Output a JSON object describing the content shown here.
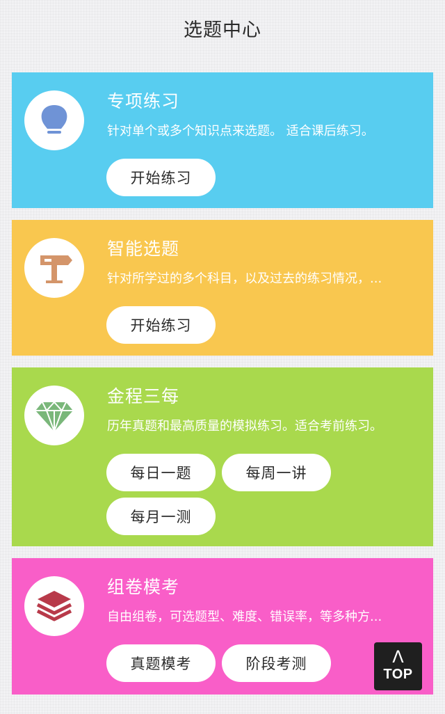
{
  "header": {
    "title": "选题中心"
  },
  "cards": [
    {
      "title": "专项练习",
      "desc": "针对单个或多个知识点来选题。 适合课后练习。",
      "icon": "lightbulb-icon",
      "color": "#58cdf0",
      "buttons": [
        "开始练习"
      ]
    },
    {
      "title": "智能选题",
      "desc": "针对所学过的多个科目，以及过去的练习情况，...",
      "icon": "signpost-icon",
      "color": "#f9c74f",
      "buttons": [
        "开始练习"
      ]
    },
    {
      "title": "金程三每",
      "desc": "历年真题和最高质量的模拟练习。适合考前练习。",
      "icon": "diamond-icon",
      "color": "#a9d94d",
      "buttons": [
        "每日一题",
        "每周一讲",
        "每月一测"
      ]
    },
    {
      "title": "组卷模考",
      "desc": "自由组卷，可选题型、难度、错误率，等多种方...",
      "icon": "layers-icon",
      "color": "#f95ec8",
      "buttons": [
        "真题模考",
        "阶段考测"
      ]
    }
  ],
  "top_button": {
    "arrow": "Λ",
    "label": "TOP"
  }
}
